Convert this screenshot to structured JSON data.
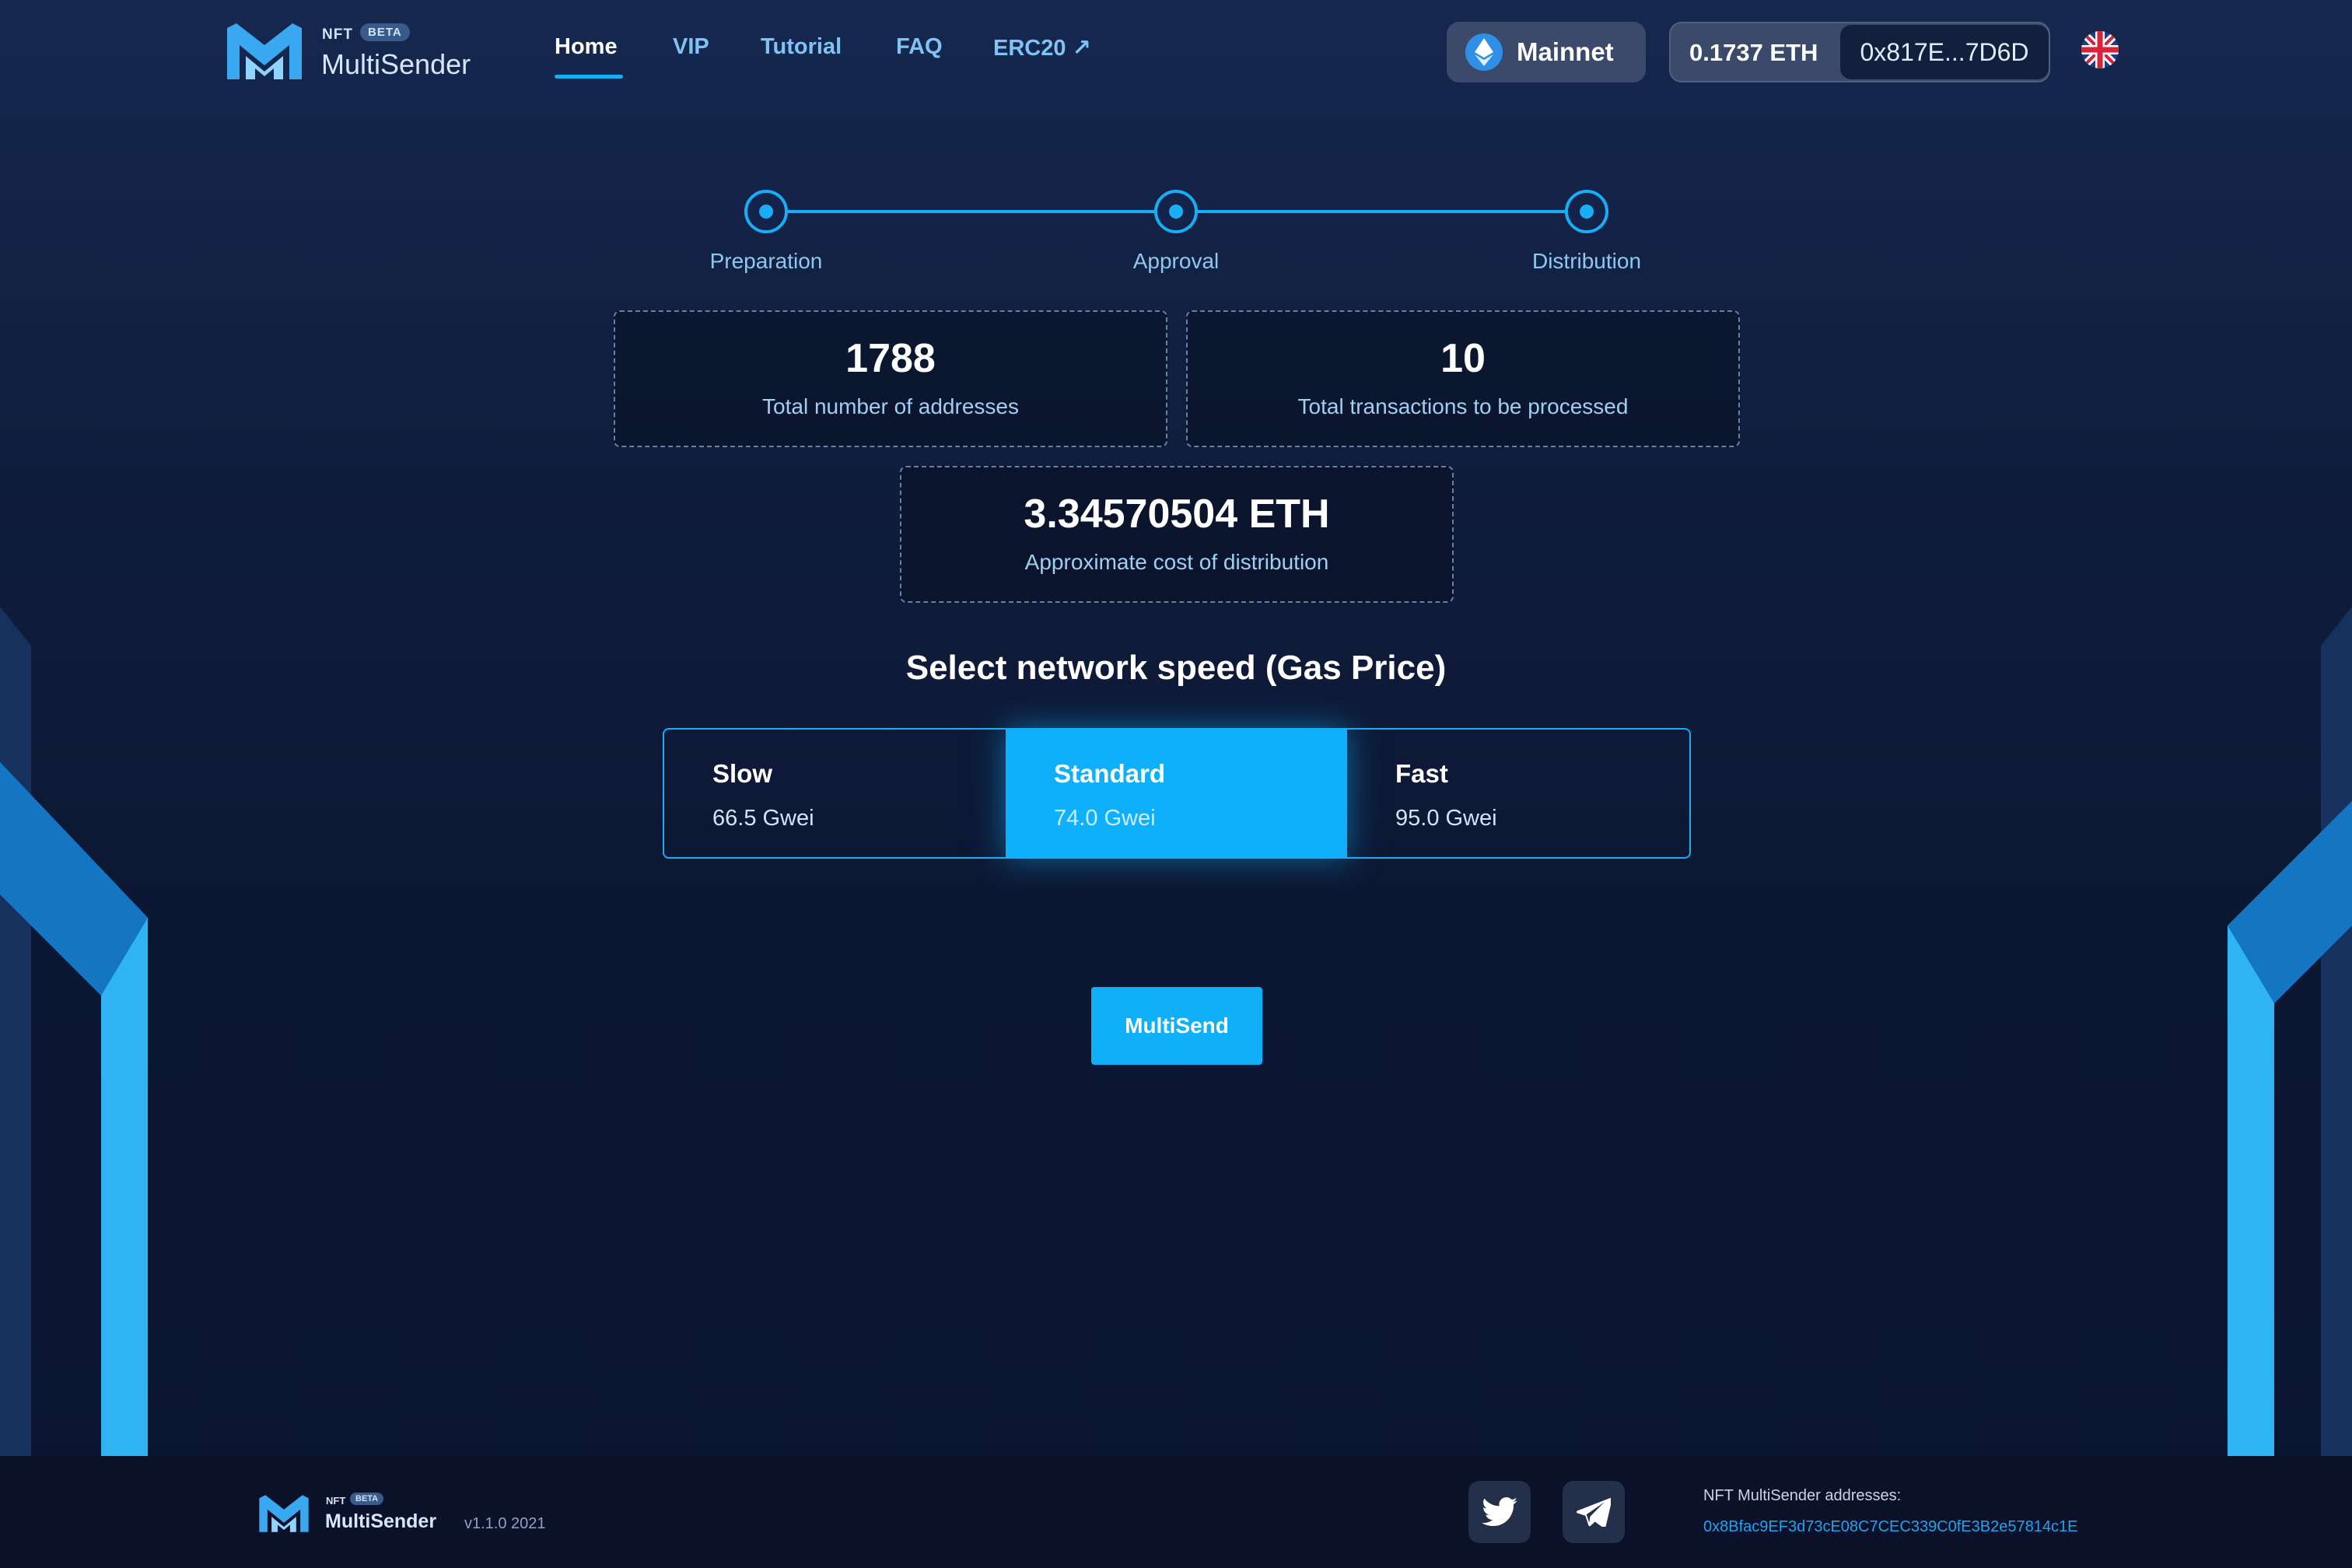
{
  "brand": {
    "nft": "NFT",
    "beta": "BETA",
    "name": "MultiSender"
  },
  "nav": {
    "items": [
      {
        "label": "Home",
        "active": true
      },
      {
        "label": "VIP"
      },
      {
        "label": "Tutorial"
      },
      {
        "label": "FAQ"
      },
      {
        "label": "ERC20 ↗"
      }
    ]
  },
  "network": {
    "label": "Mainnet",
    "icon": "ethereum-icon"
  },
  "wallet": {
    "balance": "0.1737 ETH",
    "address": "0x817E...7D6D"
  },
  "language": {
    "icon": "uk-flag-icon"
  },
  "steps": [
    {
      "label": "Preparation"
    },
    {
      "label": "Approval"
    },
    {
      "label": "Distribution"
    }
  ],
  "stats": {
    "addresses": {
      "value": "1788",
      "caption": "Total number of addresses"
    },
    "transactions": {
      "value": "10",
      "caption": "Total transactions to be processed"
    },
    "cost": {
      "value": "3.34570504 ETH",
      "caption": "Approximate cost of distribution"
    }
  },
  "speed": {
    "title": "Select network speed (Gas Price)",
    "options": [
      {
        "name": "Slow",
        "gwei": "66.5 Gwei"
      },
      {
        "name": "Standard",
        "gwei": "74.0 Gwei",
        "selected": true
      },
      {
        "name": "Fast",
        "gwei": "95.0 Gwei"
      }
    ]
  },
  "action": {
    "multisend": "MultiSend"
  },
  "footer": {
    "nft": "NFT",
    "beta": "BETA",
    "name": "MultiSender",
    "version": "v1.1.0 2021",
    "addresses_label": "NFT MultiSender addresses:",
    "address": "0x8Bfac9EF3d73cE08C7CEC339C0fE3B2e57814c1E"
  },
  "colors": {
    "accent": "#17aef5",
    "background": "#0f1d3d",
    "selected": "#0fb0fb"
  }
}
